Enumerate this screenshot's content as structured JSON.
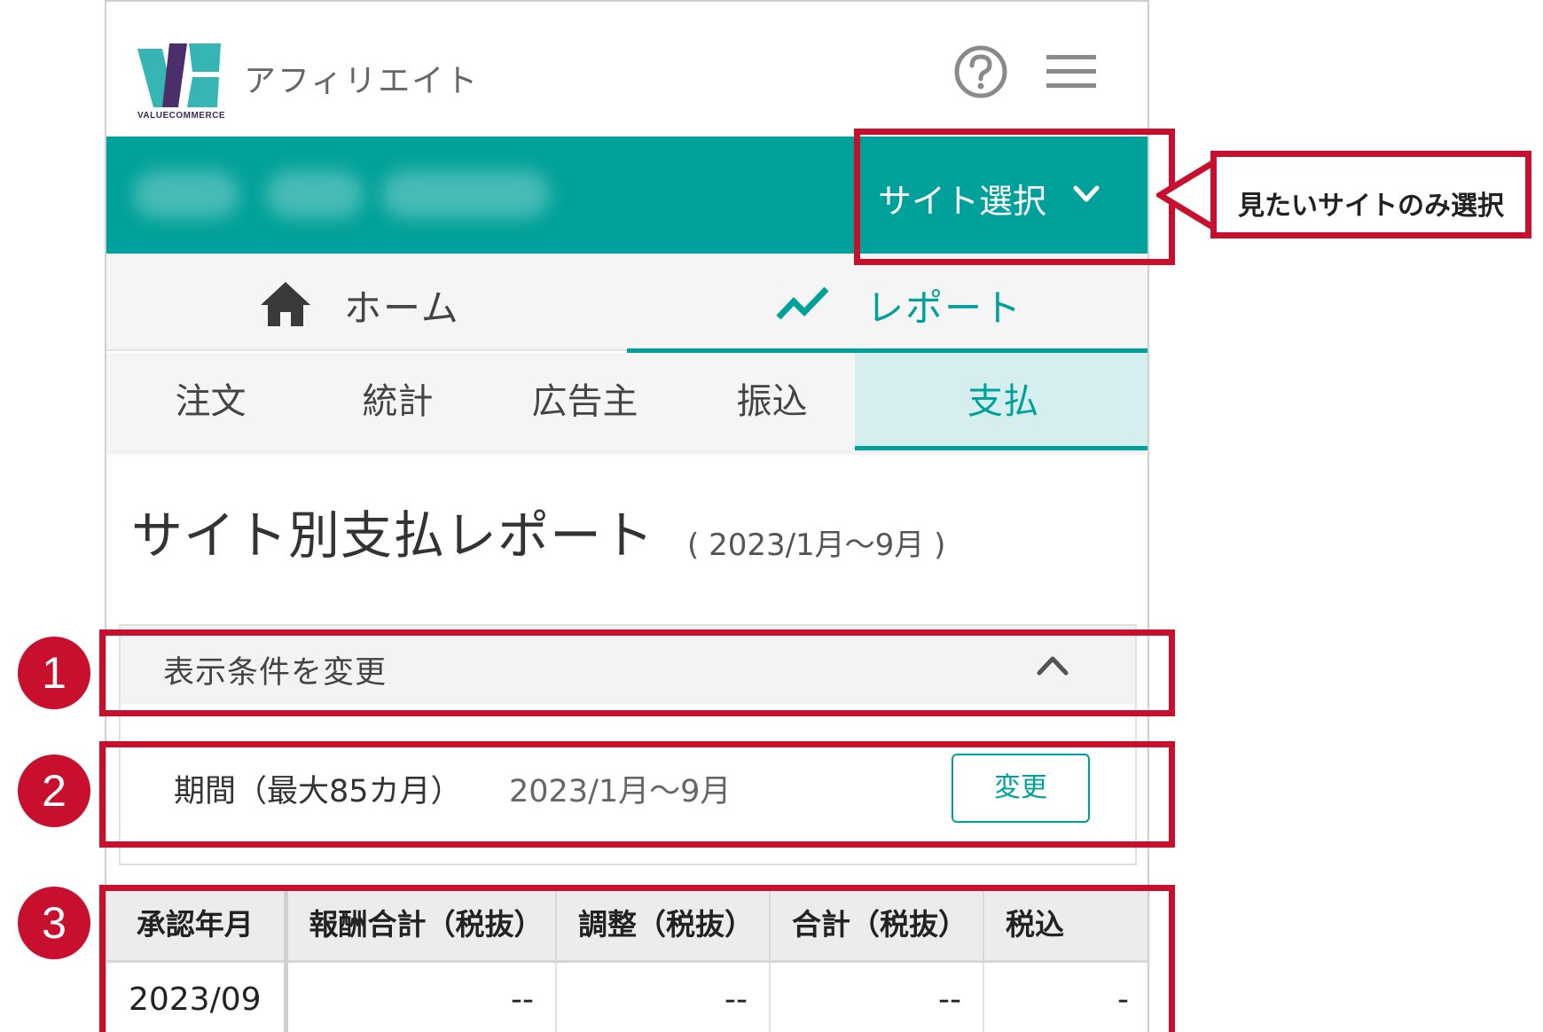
{
  "header": {
    "logo_text": "VALUECOMMERCE",
    "app_title": "アフィリエイト",
    "help_icon": "question-circle-icon",
    "menu_icon": "hamburger-menu-icon"
  },
  "sitebar": {
    "site_select_label": "サイト選択",
    "chevron_icon": "chevron-down-icon"
  },
  "nav_tabs": [
    {
      "label": "ホーム",
      "icon": "home-icon"
    },
    {
      "label": "レポート",
      "icon": "trend-chart-icon",
      "active": true
    }
  ],
  "sub_tabs": [
    {
      "label": "注文"
    },
    {
      "label": "統計"
    },
    {
      "label": "広告主"
    },
    {
      "label": "振込"
    },
    {
      "label": "支払",
      "active": true
    }
  ],
  "page": {
    "title": "サイト別支払レポート",
    "period": "( 2023/1月〜9月 )"
  },
  "conditions": {
    "header_label": "表示条件を変更",
    "period_label": "期間（最大85カ月）",
    "period_value": "2023/1月〜9月",
    "change_button": "変更"
  },
  "table": {
    "columns": [
      "承認年月",
      "報酬合計（税抜）",
      "調整（税抜）",
      "合計（税抜）",
      "税込"
    ],
    "rows": [
      [
        "2023/09",
        "--",
        "--",
        "--",
        "-"
      ]
    ]
  },
  "annotations": {
    "callout": "見たいサイトのみ選択",
    "badges": [
      "1",
      "2",
      "3"
    ]
  },
  "colors": {
    "accent": "#00a19a",
    "highlight": "#c8102e",
    "active_tab_bg": "#d6efee"
  }
}
